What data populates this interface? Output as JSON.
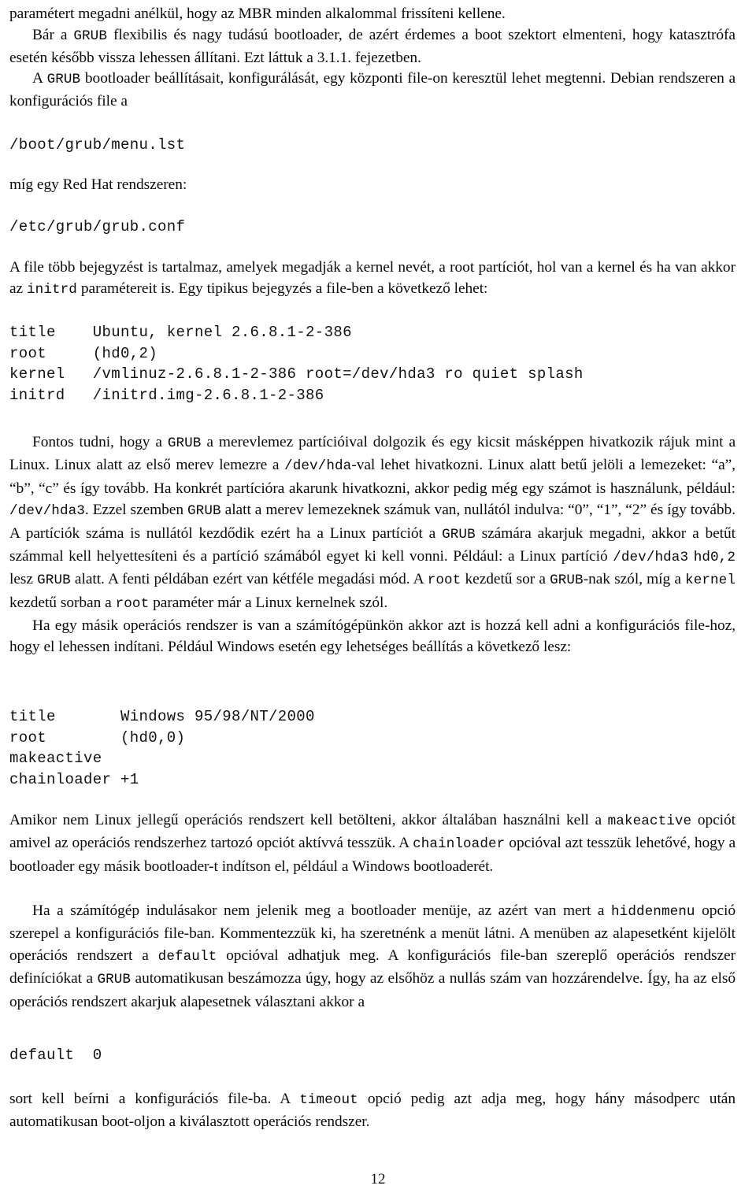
{
  "document": {
    "language": "hu",
    "page_number": "12",
    "topic": "GRUB bootloader konfiguráció"
  },
  "blocks": [
    {
      "id": "p1",
      "type": "paragraph",
      "indent": false,
      "runs": [
        {
          "t": "text",
          "v": "paramétert megadni anélkül, hogy az MBR minden alkalommal frissíteni kellene."
        }
      ]
    },
    {
      "id": "p2",
      "type": "paragraph",
      "indent": true,
      "runs": [
        {
          "t": "text",
          "v": "Bár a "
        },
        {
          "t": "mono",
          "v": "GRUB"
        },
        {
          "t": "text",
          "v": " flexibilis és nagy tudású bootloader, de azért érdemes a boot szektort elmenteni, hogy katasztrófa esetén később vissza lehessen állítani. Ezt láttuk a 3.1.1. fejezetben."
        }
      ]
    },
    {
      "id": "p3",
      "type": "paragraph",
      "indent": true,
      "runs": [
        {
          "t": "text",
          "v": "A "
        },
        {
          "t": "mono",
          "v": "GRUB"
        },
        {
          "t": "text",
          "v": " bootloader beállításait, konfigurálását, egy központi file-on keresztül lehet megtenni. Debian rendszeren a konfigurációs file a"
        }
      ]
    },
    {
      "id": "c1",
      "type": "code",
      "lines": [
        "/boot/grub/menu.lst"
      ]
    },
    {
      "id": "p4",
      "type": "paragraph",
      "indent": false,
      "runs": [
        {
          "t": "text",
          "v": "míg egy Red Hat rendszeren:"
        }
      ]
    },
    {
      "id": "c2",
      "type": "code",
      "lines": [
        "/etc/grub/grub.conf"
      ]
    },
    {
      "id": "p5",
      "type": "paragraph",
      "indent": false,
      "runs": [
        {
          "t": "text",
          "v": "A file több bejegyzést is tartalmaz, amelyek megadják a kernel nevét, a root partíciót, hol van a kernel és ha van akkor az "
        },
        {
          "t": "mono",
          "v": "initrd"
        },
        {
          "t": "text",
          "v": " paramétereit is. Egy tipikus bejegyzés a file-ben a következő lehet:"
        }
      ]
    },
    {
      "id": "c3",
      "type": "code",
      "lines": [
        "title    Ubuntu, kernel 2.6.8.1-2-386",
        "root     (hd0,2)",
        "kernel   /vmlinuz-2.6.8.1-2-386 root=/dev/hda3 ro quiet splash",
        "initrd   /initrd.img-2.6.8.1-2-386"
      ]
    },
    {
      "id": "p6",
      "type": "paragraph",
      "indent": true,
      "runs": [
        {
          "t": "text",
          "v": "Fontos tudni, hogy a "
        },
        {
          "t": "mono",
          "v": "GRUB"
        },
        {
          "t": "text",
          "v": " a merevlemez partícióival dolgozik és egy kicsit másképpen hivatkozik rájuk mint a Linux. Linux alatt az első merev lemezre a "
        },
        {
          "t": "mono",
          "v": "/dev/hda"
        },
        {
          "t": "text",
          "v": "-val lehet hivatkozni. Linux alatt betű jelöli a lemezeket: “a”, “b”, “c” és így tovább. Ha konkrét partícióra akarunk hivatkozni, akkor pedig még egy számot is használunk, például: "
        },
        {
          "t": "mono",
          "v": "/dev/hda3"
        },
        {
          "t": "text",
          "v": ". Ezzel szemben "
        },
        {
          "t": "mono",
          "v": "GRUB"
        },
        {
          "t": "text",
          "v": " alatt a merev lemezeknek számuk van, nullától indulva: “0”, “1”, “2” és így tovább. A partíciók száma is nullától kezdődik ezért ha a Linux partíciót a "
        },
        {
          "t": "mono",
          "v": "GRUB"
        },
        {
          "t": "text",
          "v": " számára akarjuk megadni, akkor a betűt számmal kell helyettesíteni és a partíció számából egyet ki kell vonni. Például: a Linux partíció "
        },
        {
          "t": "mono",
          "v": "/dev/hda3"
        },
        {
          "t": "text",
          "v": " "
        },
        {
          "t": "mono",
          "v": "hd0,2"
        },
        {
          "t": "text",
          "v": " lesz "
        },
        {
          "t": "mono",
          "v": "GRUB"
        },
        {
          "t": "text",
          "v": " alatt. A fenti példában ezért van kétféle megadási mód. A "
        },
        {
          "t": "mono",
          "v": "root"
        },
        {
          "t": "text",
          "v": " kezdetű sor a "
        },
        {
          "t": "mono",
          "v": "GRUB"
        },
        {
          "t": "text",
          "v": "-nak szól, míg a "
        },
        {
          "t": "mono",
          "v": "kernel"
        },
        {
          "t": "text",
          "v": " kezdetű sorban a "
        },
        {
          "t": "mono",
          "v": "root"
        },
        {
          "t": "text",
          "v": " paraméter már a Linux kernelnek szól."
        }
      ]
    },
    {
      "id": "p7",
      "type": "paragraph",
      "indent": true,
      "runs": [
        {
          "t": "text",
          "v": "Ha egy másik operációs rendszer is van a számítógépünkön akkor azt is hozzá kell adni a konfigurációs file-hoz, hogy el lehessen indítani. Például Windows esetén egy lehetséges beállítás a következő lesz:"
        }
      ]
    },
    {
      "id": "c4",
      "type": "code",
      "lines": [
        "title       Windows 95/98/NT/2000",
        "root        (hd0,0)",
        "makeactive",
        "chainloader +1"
      ]
    },
    {
      "id": "p8",
      "type": "paragraph",
      "indent": false,
      "runs": [
        {
          "t": "text",
          "v": "Amikor nem Linux jellegű operációs rendszert kell betölteni, akkor általában használni kell a "
        },
        {
          "t": "mono",
          "v": "makeactive"
        },
        {
          "t": "text",
          "v": " opciót amivel az operációs rendszerhez tartozó opciót aktívvá tesszük. A "
        },
        {
          "t": "mono",
          "v": "chainloader"
        },
        {
          "t": "text",
          "v": " opcióval azt tesszük lehetővé, hogy a bootloader egy másik bootloader-t indítson el, például a Windows bootloaderét."
        }
      ]
    },
    {
      "id": "p9",
      "type": "paragraph",
      "indent": true,
      "runs": [
        {
          "t": "text",
          "v": "Ha a számítógép indulásakor nem jelenik meg a bootloader menüje, az azért van mert a "
        },
        {
          "t": "mono",
          "v": "hiddenmenu"
        },
        {
          "t": "text",
          "v": " opció szerepel a konfigurációs file-ban. Kommentezzük ki, ha szeretnénk a menüt látni. A menüben az alapesetként kijelölt operációs rendszert a "
        },
        {
          "t": "mono",
          "v": "default"
        },
        {
          "t": "text",
          "v": " opcióval adhatjuk meg. A konfigurációs file-ban szereplő operációs rendszer definíciókat a "
        },
        {
          "t": "mono",
          "v": "GRUB"
        },
        {
          "t": "text",
          "v": " automatikusan beszámozza úgy, hogy az elsőhöz a nullás szám van hozzárendelve. Így, ha az első operációs rendszert akarjuk alapesetnek választani akkor a"
        }
      ]
    },
    {
      "id": "c5",
      "type": "code",
      "lines": [
        "default  0"
      ]
    },
    {
      "id": "p10",
      "type": "paragraph",
      "indent": false,
      "runs": [
        {
          "t": "text",
          "v": "sort kell beírni a konfigurációs file-ba. A "
        },
        {
          "t": "mono",
          "v": "timeout"
        },
        {
          "t": "text",
          "v": " opció pedig azt adja meg, hogy hány másodperc után automatikusan boot-oljon a kiválasztott operációs rendszer."
        }
      ]
    }
  ],
  "layout": {
    "positions": {
      "p1": 4,
      "p2": 31,
      "p3": 86,
      "c1": 171,
      "p4": 221,
      "c2": 275,
      "p5": 326,
      "c3": 409,
      "p6": 548,
      "p7": 781,
      "c4": 897,
      "p8": 1028,
      "p9": 1143,
      "c5": 1327,
      "p10": 1382
    }
  }
}
